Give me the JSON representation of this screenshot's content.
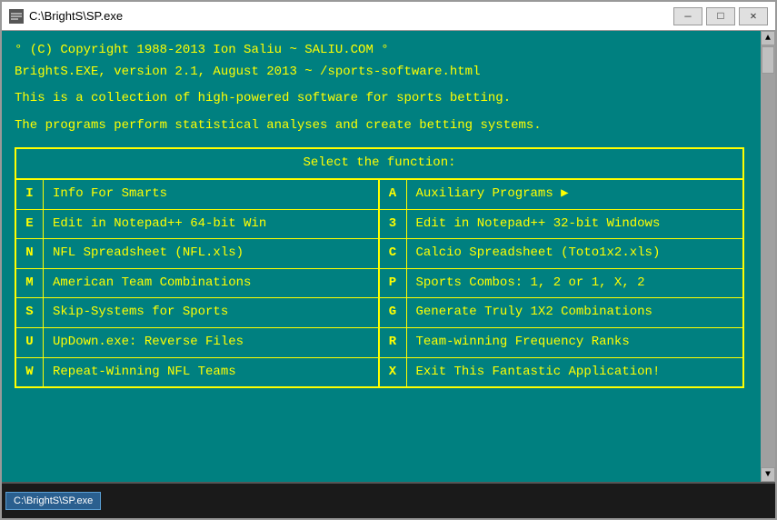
{
  "window": {
    "title": "C:\\BrightS\\SP.exe",
    "icon": "■"
  },
  "controls": {
    "minimize": "—",
    "maximize": "□",
    "close": "✕"
  },
  "console": {
    "line1": "° (C) Copyright 1988-2013 Ion Saliu ~ SALIU.COM °",
    "line2": "BrightS.EXE, version 2.1, August 2013 ~ /sports-software.html",
    "line3": "This is a collection of high-powered software for sports betting.",
    "line4": "The programs perform statistical analyses and create betting systems.",
    "menu_header": "Select the function:",
    "menu_items_left": [
      {
        "key": "I",
        "label": "Info For Smarts"
      },
      {
        "key": "E",
        "label": "Edit in Notepad++ 64-bit Win"
      },
      {
        "key": "N",
        "label": "NFL Spreadsheet (NFL.xls)"
      },
      {
        "key": "M",
        "label": "American Team Combinations"
      },
      {
        "key": "S",
        "label": "Skip-Systems for Sports"
      },
      {
        "key": "U",
        "label": "UpDown.exe: Reverse Files"
      },
      {
        "key": "W",
        "label": "Repeat-Winning NFL Teams"
      }
    ],
    "menu_items_right": [
      {
        "key": "A",
        "label": "Auxiliary Programs",
        "arrow": "▶"
      },
      {
        "key": "3",
        "label": "Edit in Notepad++ 32-bit Windows"
      },
      {
        "key": "C",
        "label": "Calcio Spreadsheet (Toto1x2.xls)"
      },
      {
        "key": "P",
        "label": "Sports Combos:  1, 2 or 1, X, 2"
      },
      {
        "key": "G",
        "label": "Generate Truly 1X2 Combinations"
      },
      {
        "key": "R",
        "label": "Team-winning Frequency Ranks"
      },
      {
        "key": "X",
        "label": "Exit This Fantastic Application!"
      }
    ]
  },
  "taskbar": {
    "item_label": "C:\\BrightS\\SP.exe"
  }
}
